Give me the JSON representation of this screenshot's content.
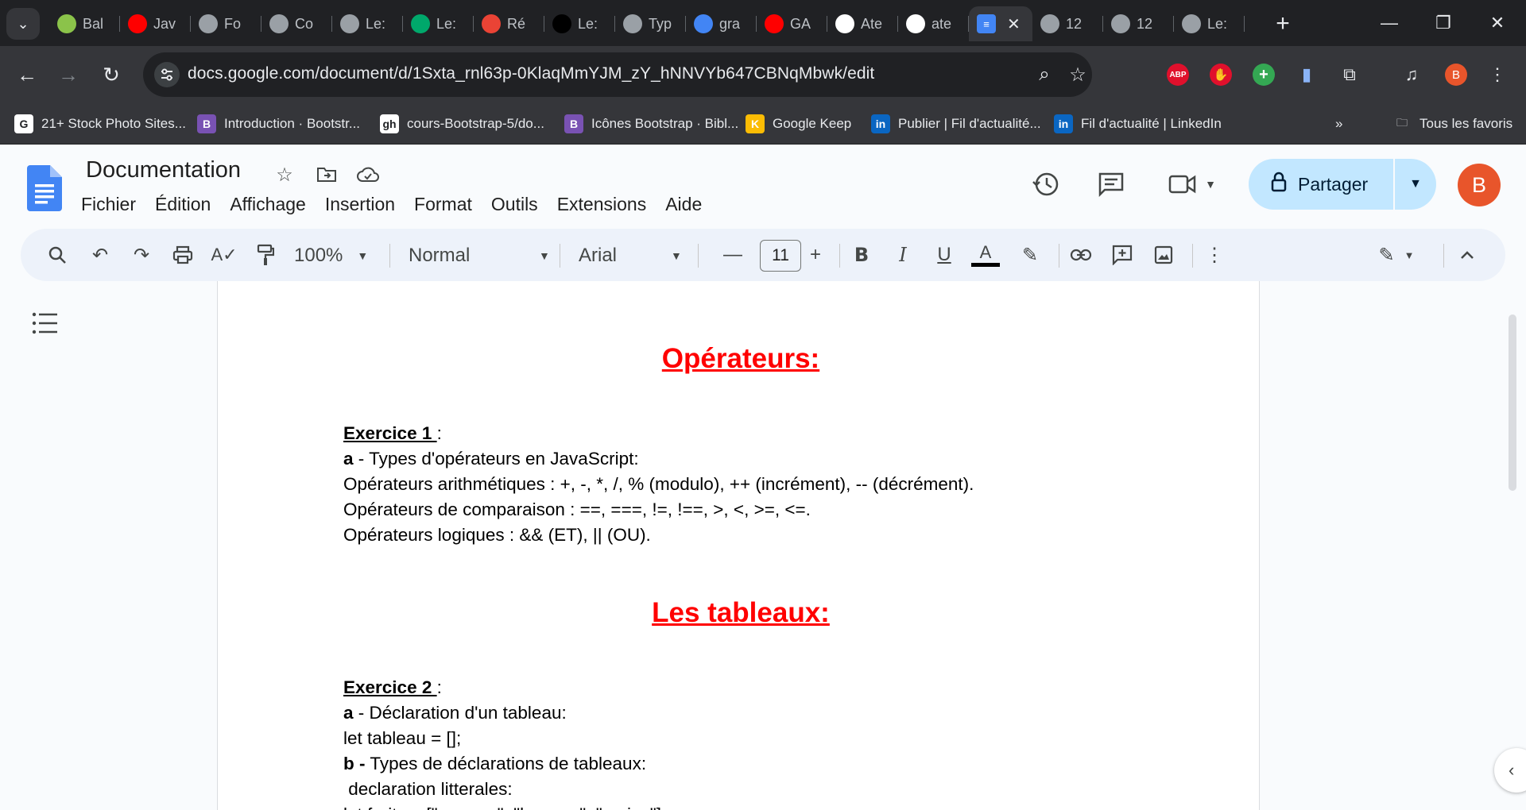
{
  "browser": {
    "tabs": [
      {
        "icon": "app-icon",
        "color": "#8bc34a",
        "label": "Bal"
      },
      {
        "icon": "youtube-icon",
        "color": "#ff0000",
        "label": "Jav"
      },
      {
        "icon": "globe-icon",
        "color": "#9aa0a6",
        "label": "Fo"
      },
      {
        "icon": "globe-icon",
        "color": "#9aa0a6",
        "label": "Co"
      },
      {
        "icon": "globe-icon",
        "color": "#9aa0a6",
        "label": "Le:"
      },
      {
        "icon": "app-icon",
        "color": "#00a86b",
        "label": "Le:"
      },
      {
        "icon": "gmail-icon",
        "color": "#ea4335",
        "label": "Ré"
      },
      {
        "icon": "medium-icon",
        "color": "#000000",
        "label": "Le:"
      },
      {
        "icon": "globe-icon",
        "color": "#9aa0a6",
        "label": "Typ"
      },
      {
        "icon": "google-icon",
        "color": "#4285f4",
        "label": "gra"
      },
      {
        "icon": "youtube-icon",
        "color": "#ff0000",
        "label": "GA"
      },
      {
        "icon": "github-icon",
        "color": "#ffffff",
        "label": "Ate"
      },
      {
        "icon": "github-icon",
        "color": "#ffffff",
        "label": "ate"
      }
    ],
    "tabs_after": [
      {
        "icon": "globe-icon",
        "color": "#9aa0a6",
        "label": "12"
      },
      {
        "icon": "globe-icon",
        "color": "#9aa0a6",
        "label": "12"
      },
      {
        "icon": "globe-icon",
        "color": "#9aa0a6",
        "label": "Le:"
      }
    ],
    "active_tab_close": "✕",
    "url": "docs.google.com/document/d/1Sxta_rnl63p-0KlaqMmYJM_zY_hNNVYb647CBNqMbwk/edit",
    "extension_abp": "ABP",
    "profile_initial": "B",
    "bookmarks": [
      {
        "icon": "G",
        "color": "#ffffff",
        "label": "21+ Stock Photo Sites..."
      },
      {
        "icon": "B",
        "color": "#7952b3",
        "label": "Introduction · Bootstr..."
      },
      {
        "icon": "gh",
        "color": "#ffffff",
        "label": "cours-Bootstrap-5/do..."
      },
      {
        "icon": "B",
        "color": "#7952b3",
        "label": "Icônes Bootstrap · Bibl..."
      },
      {
        "icon": "K",
        "color": "#fbbc04",
        "label": "Google Keep"
      },
      {
        "icon": "in",
        "color": "#0a66c2",
        "label": "Publier | Fil d'actualité..."
      },
      {
        "icon": "in",
        "color": "#0a66c2",
        "label": "Fil d'actualité | LinkedIn"
      }
    ],
    "bookmarks_more": "»",
    "all_bookmarks": "Tous les favoris"
  },
  "docs": {
    "title": "Documentation",
    "menu": [
      "Fichier",
      "Édition",
      "Affichage",
      "Insertion",
      "Format",
      "Outils",
      "Extensions",
      "Aide"
    ],
    "share_label": "Partager",
    "avatar_initial": "B",
    "toolbar": {
      "zoom": "100%",
      "style": "Normal",
      "font": "Arial",
      "font_size": "11"
    },
    "accent": "#c2e7ff",
    "heading_color": "#ff0000"
  },
  "document": {
    "heading1": "Opérateurs:",
    "ex1_title": "Exercice 1 ",
    "ex1_colon": ":",
    "ex1_a_bold": "a",
    "ex1_a_text": " - Types d'opérateurs en JavaScript:",
    "ex1_line1": "Opérateurs arithmétiques : +, -, *, /, % (modulo), ++ (incrément), -- (décrément).",
    "ex1_line2": "Opérateurs de comparaison : ==, ===, !=, !==, >, <, >=, <=.",
    "ex1_line3": "Opérateurs logiques : && (ET), || (OU).",
    "heading2": "Les tableaux:",
    "ex2_title": "Exercice 2 ",
    "ex2_colon": ":",
    "ex2_a_bold": "a",
    "ex2_a_text": " - Déclaration d'un tableau:",
    "ex2_line1": "let tableau = [];",
    "ex2_b_bold": "b -",
    "ex2_b_text": " Types de déclarations de tableaux:",
    "ex2_line2": " declaration litterales:",
    "ex2_line3": "let fruits = [\"pomme\", \"banane\", \"cerise\"];"
  }
}
